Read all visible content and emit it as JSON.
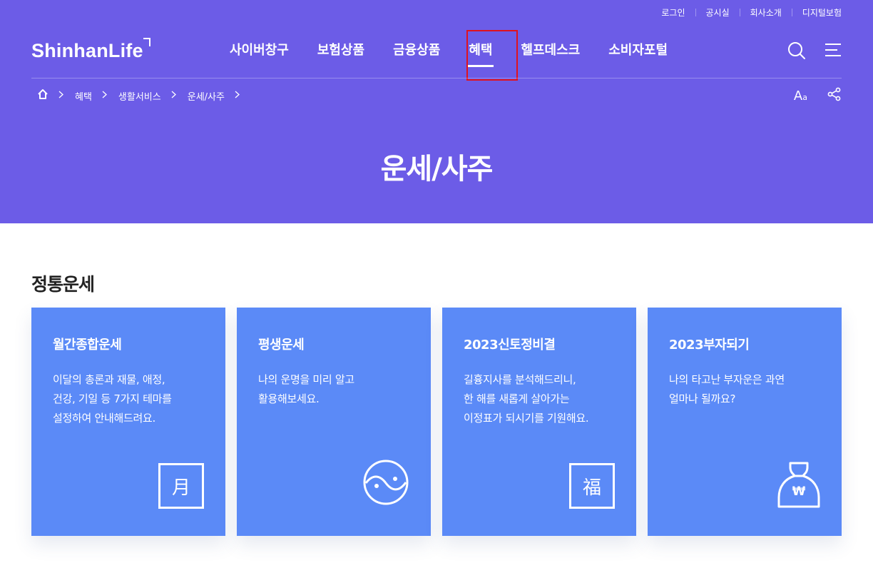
{
  "util_nav": [
    "로그인",
    "공시실",
    "회사소개",
    "디지털보험"
  ],
  "logo": "ShinhanLife",
  "gnb": [
    {
      "label": "사이버창구"
    },
    {
      "label": "보험상품"
    },
    {
      "label": "금융상품"
    },
    {
      "label": "혜택",
      "active": true
    },
    {
      "label": "헬프데스크"
    },
    {
      "label": "소비자포털"
    }
  ],
  "icons": {
    "search": "search-icon",
    "menu": "hamburger-menu-icon",
    "home": "home-icon",
    "share": "share-icon"
  },
  "breadcrumb": [
    "혜택",
    "생활서비스",
    "운세/사주"
  ],
  "font_size_button": {
    "big": "A",
    "small": "a"
  },
  "page_title": "운세/사주",
  "section_title": "정통운세",
  "cards": [
    {
      "title": "월간종합운세",
      "desc": "이달의 총론과 재물, 애정,\n건강, 기일 등 7가지 테마를\n설정하여 안내해드려요.",
      "icon_text": "月",
      "icon": "moon-character-icon"
    },
    {
      "title": "평생운세",
      "desc": "나의 운명을 미리 알고\n활용해보세요.",
      "icon": "yin-yang-icon"
    },
    {
      "title": "2023신토정비결",
      "desc": "길흉지사를 분석해드리니,\n한 해를 새롭게 살아가는\n이정표가 되시기를 기원해요.",
      "icon_text": "福",
      "icon": "fortune-character-icon"
    },
    {
      "title": "2023부자되기",
      "desc": "나의 타고난 부자운은 과연\n얼마나 될까요?",
      "icon_text": "₩",
      "icon": "money-bag-icon"
    }
  ],
  "colors": {
    "hero_bg": "#6c5ce7",
    "card_bg": "#5b8af7",
    "highlight": "#e0121e"
  }
}
